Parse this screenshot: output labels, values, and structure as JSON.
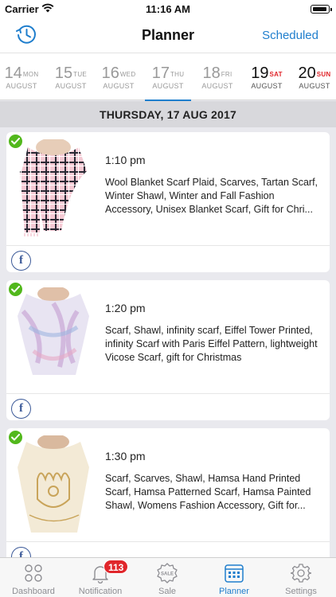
{
  "status_bar": {
    "carrier": "Carrier",
    "time": "11:16 AM"
  },
  "navbar": {
    "title": "Planner",
    "right_action": "Scheduled",
    "left_icon": "history-clock-icon"
  },
  "date_strip": [
    {
      "num": "14",
      "day": "MON",
      "month": "AUGUST",
      "state": "past"
    },
    {
      "num": "15",
      "day": "TUE",
      "month": "AUGUST",
      "state": "past"
    },
    {
      "num": "16",
      "day": "WED",
      "month": "AUGUST",
      "state": "past"
    },
    {
      "num": "17",
      "day": "THU",
      "month": "AUGUST",
      "state": "active"
    },
    {
      "num": "18",
      "day": "FRI",
      "month": "AUGUST",
      "state": "past"
    },
    {
      "num": "19",
      "day": "SAT",
      "month": "AUGUST",
      "state": "future-weekend"
    },
    {
      "num": "20",
      "day": "SUN",
      "month": "AUGUST",
      "state": "future-weekend"
    }
  ],
  "section_header": "THURSDAY, 17 AUG 2017",
  "posts": [
    {
      "time": "1:10 pm",
      "description": "Wool Blanket Scarf Plaid, Scarves, Tartan Scarf, Winter Shawl, Winter and Fall Fashion Accessory, Unisex Blanket Scarf, Gift for Chri...",
      "network": "f",
      "status_icon": "check-icon"
    },
    {
      "time": "1:20 pm",
      "description": "Scarf, Shawl, infinity scarf, Eiffel Tower Printed, infinity Scarf with Paris Eiffel Pattern, lightweight Vicose Scarf, gift for Christmas",
      "network": "f",
      "status_icon": "check-icon"
    },
    {
      "time": "1:30 pm",
      "description": "Scarf, Scarves, Shawl, Hamsa Hand Printed Scarf, Hamsa Patterned Scarf, Hamsa Painted Shawl, Womens Fashion Accessory, Gift for...",
      "network": "f",
      "status_icon": "check-icon"
    }
  ],
  "tabbar": [
    {
      "label": "Dashboard",
      "icon": "dashboard-icon",
      "active": false
    },
    {
      "label": "Notification",
      "icon": "bell-icon",
      "active": false,
      "badge": "113"
    },
    {
      "label": "Sale",
      "icon": "sale-tag-icon",
      "active": false,
      "icon_text": "SALE"
    },
    {
      "label": "Planner",
      "icon": "calendar-icon",
      "active": true
    },
    {
      "label": "Settings",
      "icon": "gear-icon",
      "active": false
    }
  ],
  "colors": {
    "accent": "#1f7ecd",
    "weekend": "#e0262b",
    "success": "#52b81c",
    "facebook": "#3b5998",
    "badge": "#e0262b"
  }
}
